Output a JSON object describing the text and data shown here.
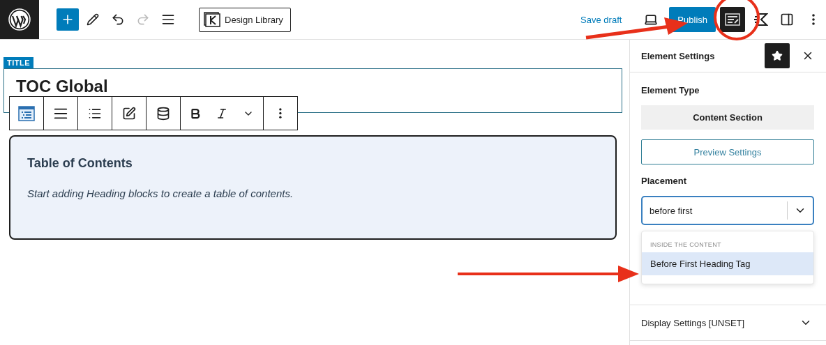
{
  "top_bar": {
    "design_library": "Design Library",
    "save_draft": "Save draft",
    "publish": "Publish"
  },
  "editor": {
    "title_badge": "TITLE",
    "title": "TOC Global",
    "block": {
      "heading": "Table of Contents",
      "hint": "Start adding Heading blocks to create a table of contents."
    }
  },
  "sidebar": {
    "title": "Element Settings",
    "element_type": {
      "label": "Element Type",
      "value": "Content Section"
    },
    "preview_button": "Preview Settings",
    "placement": {
      "label": "Placement",
      "value": "before first",
      "group": "INSIDE THE CONTENT",
      "options": [
        {
          "label": "Before First Heading Tag",
          "selected": true
        }
      ]
    },
    "sections": [
      {
        "label": "Display Settings [UNSET]",
        "expanded": false
      }
    ]
  }
}
